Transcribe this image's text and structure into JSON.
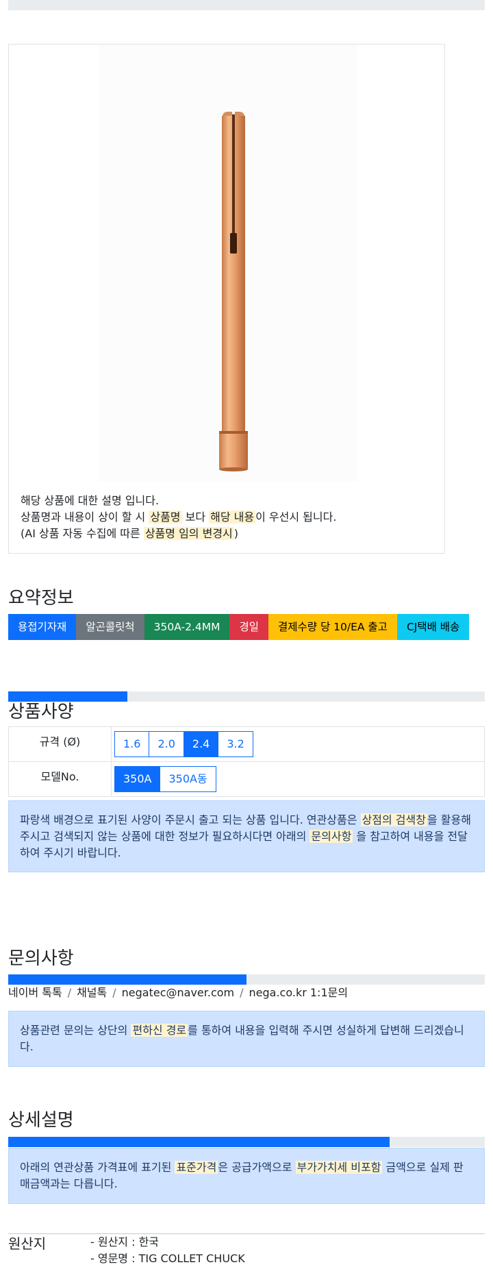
{
  "card": {
    "line1": "해당 상품에 대한 설명 입니다.",
    "line2": {
      "a": "상품명과 내용이 상이 할 시 ",
      "b": "상품명",
      "c": " 보다 ",
      "d": "해당 내용",
      "e": "이 우선시 됩니다."
    },
    "line3": {
      "a": "(AI 상품 자동 수집에 따른 ",
      "b": "상품명 임의 변경시",
      "c": ")"
    }
  },
  "summary": {
    "title": "요약정보",
    "badges": [
      {
        "label": "용접기자재",
        "bg": "#0d6efd",
        "fg": "#ffffff"
      },
      {
        "label": "알곤콜릿척",
        "bg": "#6c757d",
        "fg": "#ffffff"
      },
      {
        "label": "350A-2.4MM",
        "bg": "#198754",
        "fg": "#ffffff"
      },
      {
        "label": "경일",
        "bg": "#dc3545",
        "fg": "#ffffff"
      },
      {
        "label": "결제수량 당 10/EA 출고",
        "bg": "#ffc107",
        "fg": "#000000"
      },
      {
        "label": "CJ택배 배송",
        "bg": "#0dcaf0",
        "fg": "#000000"
      }
    ]
  },
  "specs": {
    "title": "상품사양",
    "progress": 0.25,
    "rows": [
      {
        "label": "규격 (Ø)",
        "options": [
          "1.6",
          "2.0",
          "2.4",
          "3.2"
        ],
        "selected": "2.4"
      },
      {
        "label": "모델No.",
        "options": [
          "350A",
          "350A동"
        ],
        "selected": "350A"
      }
    ],
    "note": {
      "a": "파랑색 배경으로 표기된 사양이 주문시 출고 되는 상품 입니다. 연관상품은 ",
      "b": "상점의 검색창",
      "c": "을 활용해 주시고 검색되지 않는 상품에 대한 정보가 필요하시다면 아래의 ",
      "d": "문의사항",
      "e": " 을 참고하여 내용을 전달하여 주시기 바랍니다."
    }
  },
  "inquiry": {
    "title": "문의사항",
    "progress": 0.5,
    "contacts": [
      "네이버 톡톡",
      "채널톡",
      "negatec@naver.com",
      "nega.co.kr 1:1문의"
    ],
    "note": {
      "a": "상품관련 문의는 상단의 ",
      "b": "편하신 경로",
      "c": "를 통하여 내용을 입력해 주시면 성실하게 답변해 드리겠습니다."
    }
  },
  "detail": {
    "title": "상세설명",
    "progress": 0.8,
    "note": {
      "a": "아래의 연관상품 가격표에 표기된 ",
      "b": "표준가격",
      "c": "은 공급가액으로 ",
      "d": "부가가치세 비포함",
      "e": " 금액으로 실제 판매금액과는 다릅니다."
    }
  },
  "origin": {
    "title": "원산지",
    "lines": [
      "- 원산지 : 한국",
      "- 영문명 : TIG COLLET CHUCK"
    ]
  },
  "colors": {
    "primary": "#0d6efd",
    "info_bg": "#cfe2ff",
    "highlight": "#fff3cd",
    "copper": "#e8a06a"
  }
}
